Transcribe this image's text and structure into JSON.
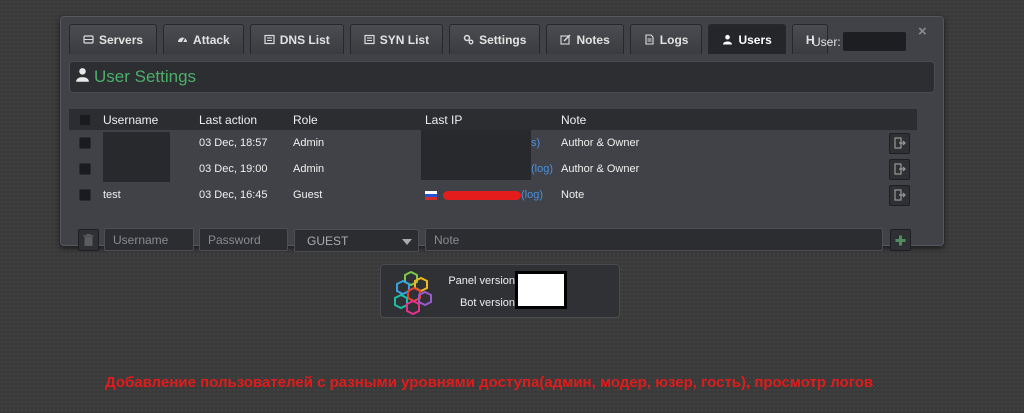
{
  "tabs": [
    {
      "label": "Servers",
      "icon": "server-icon"
    },
    {
      "label": "Attack",
      "icon": "gauge-icon"
    },
    {
      "label": "DNS List",
      "icon": "list-icon"
    },
    {
      "label": "SYN List",
      "icon": "list-icon"
    },
    {
      "label": "Settings",
      "icon": "gears-icon"
    },
    {
      "label": "Notes",
      "icon": "edit-icon"
    },
    {
      "label": "Logs",
      "icon": "file-icon"
    },
    {
      "label": "Users",
      "icon": "user-icon",
      "active": true
    },
    {
      "label": "H"
    }
  ],
  "header": {
    "user_label": "User:",
    "close": "×"
  },
  "section": {
    "title": "User Settings",
    "icon": "user-icon",
    "title_color": "#4caf6a"
  },
  "table": {
    "columns": [
      "Username",
      "Last action",
      "Role",
      "Last IP",
      "Note"
    ],
    "rows": [
      {
        "username": "",
        "last_action": "03 Dec, 18:57",
        "role": "Admin",
        "last_ip": "",
        "logs_link": "s)",
        "note": "Author & Owner"
      },
      {
        "username": "",
        "last_action": "03 Dec, 19:00",
        "role": "Admin",
        "last_ip": "",
        "logs_link": "(log)",
        "note": "Author & Owner"
      },
      {
        "username": "test",
        "last_action": "03 Dec, 16:45",
        "role": "Guest",
        "last_ip": "",
        "logs_link": "(log)",
        "note": "Note"
      }
    ]
  },
  "form": {
    "username_placeholder": "Username",
    "password_placeholder": "Password",
    "role_selected": "GUEST",
    "note_placeholder": "Note"
  },
  "version": {
    "panel_label": "Panel version",
    "bot_label": "Bot version"
  },
  "caption": "Добавление пользователей с разными уровнями доступа(админ, модер, юзер, гость), просмотр логов",
  "colors": {
    "accent": "#4caf6a",
    "link": "#4a8fdd",
    "caption": "#e01b1b"
  }
}
